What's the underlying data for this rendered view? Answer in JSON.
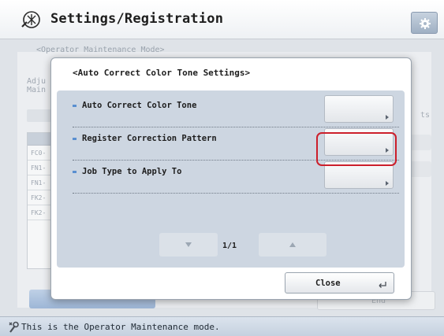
{
  "header": {
    "title": "Settings/Registration",
    "logo_icon": "settings-registration-icon",
    "gear_icon": "gear-icon"
  },
  "background": {
    "breadcrumb": "<Operator Maintenance Mode>",
    "adjust_label_line1": "Adju",
    "adjust_label_line2": "Main",
    "list_rows": [
      "FC0-",
      "FN1-",
      "FN1-",
      "FK2-",
      "FK2-"
    ],
    "right_label": "ts",
    "end_label": "End"
  },
  "dialog": {
    "title": "<Auto Correct Color Tone Settings>",
    "items": [
      {
        "label": "Auto Correct Color Tone"
      },
      {
        "label": "Register Correction Pattern"
      },
      {
        "label": "Job Type to Apply To"
      }
    ],
    "page_indicator": "1/1",
    "close_label": "Close"
  },
  "status_bar": {
    "text": "This is the Operator Maintenance mode.",
    "icon": "wrench-icon"
  },
  "colors": {
    "highlight": "#cc1f2b",
    "dialog_panel": "#cdd6e1",
    "bullet": "#5a8fd0"
  }
}
